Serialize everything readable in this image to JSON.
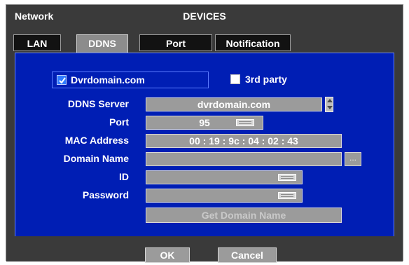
{
  "window": {
    "menu": "Network",
    "title": "DEVICES"
  },
  "tabs": [
    {
      "label": "LAN",
      "active": false
    },
    {
      "label": "DDNS",
      "active": true
    },
    {
      "label": "Port",
      "active": false
    },
    {
      "label": "Notification",
      "active": false
    }
  ],
  "ddns": {
    "option_dvrdomain": {
      "label": "Dvrdomain.com",
      "checked": true
    },
    "option_third_party": {
      "label": "3rd party",
      "checked": false
    },
    "server": {
      "label": "DDNS Server",
      "value": "dvrdomain.com"
    },
    "port": {
      "label": "Port",
      "value": "95"
    },
    "mac": {
      "label": "MAC Address",
      "value": "00 : 19 : 9c : 04 : 02 : 43"
    },
    "domain": {
      "label": "Domain Name",
      "value": "",
      "browse": "..."
    },
    "id": {
      "label": "ID",
      "value": ""
    },
    "password": {
      "label": "Password",
      "value": ""
    },
    "get_domain": "Get Domain Name"
  },
  "buttons": {
    "ok": "OK",
    "cancel": "Cancel"
  },
  "colors": {
    "panel": "#001eb4",
    "window": "#3a3a3a",
    "field": "#9b9b9b",
    "checkbox_on": "#2f7bff"
  }
}
